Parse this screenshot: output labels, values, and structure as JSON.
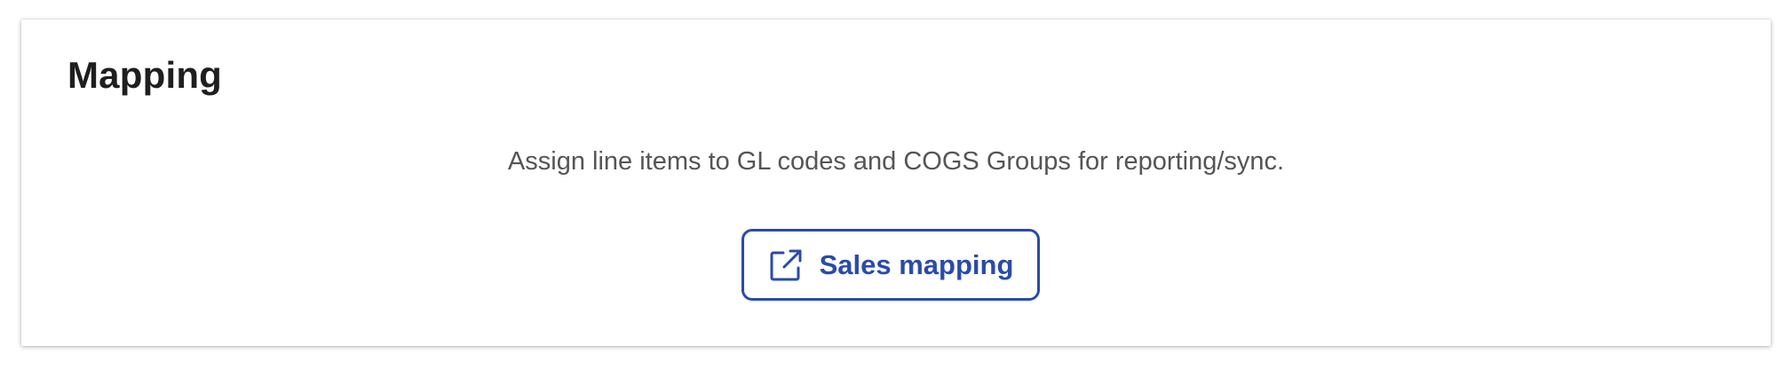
{
  "card": {
    "title": "Mapping",
    "description": "Assign line items to GL codes and COGS Groups for reporting/sync."
  },
  "action": {
    "label": "Sales mapping",
    "icon": "external-link-icon",
    "accent_color": "#2a4ba8"
  }
}
